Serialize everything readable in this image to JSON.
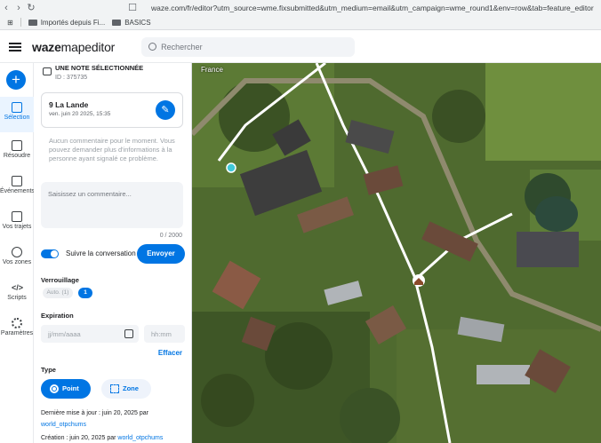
{
  "browser": {
    "url": "waze.com/fr/editor?utm_source=wme.fixsubmitted&utm_medium=email&utm_campaign=wme_round1&env=row&tab=feature_editor",
    "bookmarks": [
      "Importés depuis Fi...",
      "BASICS"
    ]
  },
  "header": {
    "logo_bold": "waze",
    "logo_rest": "mapeditor",
    "search_placeholder": "Rechercher"
  },
  "rail": {
    "items": [
      {
        "label": "Sélection",
        "icon": "selection-icon"
      },
      {
        "label": "Résoudre",
        "icon": "resolve-icon"
      },
      {
        "label": "Événements",
        "icon": "events-icon"
      },
      {
        "label": "Vos trajets",
        "icon": "car-icon"
      },
      {
        "label": "Vos zones",
        "icon": "globe-icon"
      },
      {
        "label": "Scripts",
        "icon": "code-icon"
      },
      {
        "label": "Paramètres",
        "icon": "gear-icon"
      }
    ]
  },
  "note": {
    "heading": "UNE NOTE SÉLECTIONNÉE",
    "id": "ID : 375735",
    "title": "9 La Lande",
    "date": "ven. juin 20 2025, 15:35",
    "empty_text": "Aucun commentaire pour le moment. Vous pouvez demander plus d'informations à la personne ayant signalé ce problème.",
    "comment_placeholder": "Saisissez un commentaire...",
    "counter": "0 / 2000",
    "follow_label": "Suivre la conversation",
    "send_label": "Envoyer",
    "lock_label": "Verrouillage",
    "lock_auto": "Auto. (1)",
    "lock_value": "1",
    "expiration_label": "Expiration",
    "date_placeholder": "jj/mm/aaaa",
    "time_placeholder": "hh:mm",
    "clear_label": "Effacer",
    "type_label": "Type",
    "type_point": "Point",
    "type_zone": "Zone",
    "updated_text": "Dernière mise à jour : juin 20, 2025 par",
    "updated_user": "world_otpchums",
    "created_text": "Création : juin 20, 2025 par",
    "created_user": "world_otpchums"
  },
  "map": {
    "country_label": "France"
  },
  "colors": {
    "accent": "#0075e3"
  }
}
